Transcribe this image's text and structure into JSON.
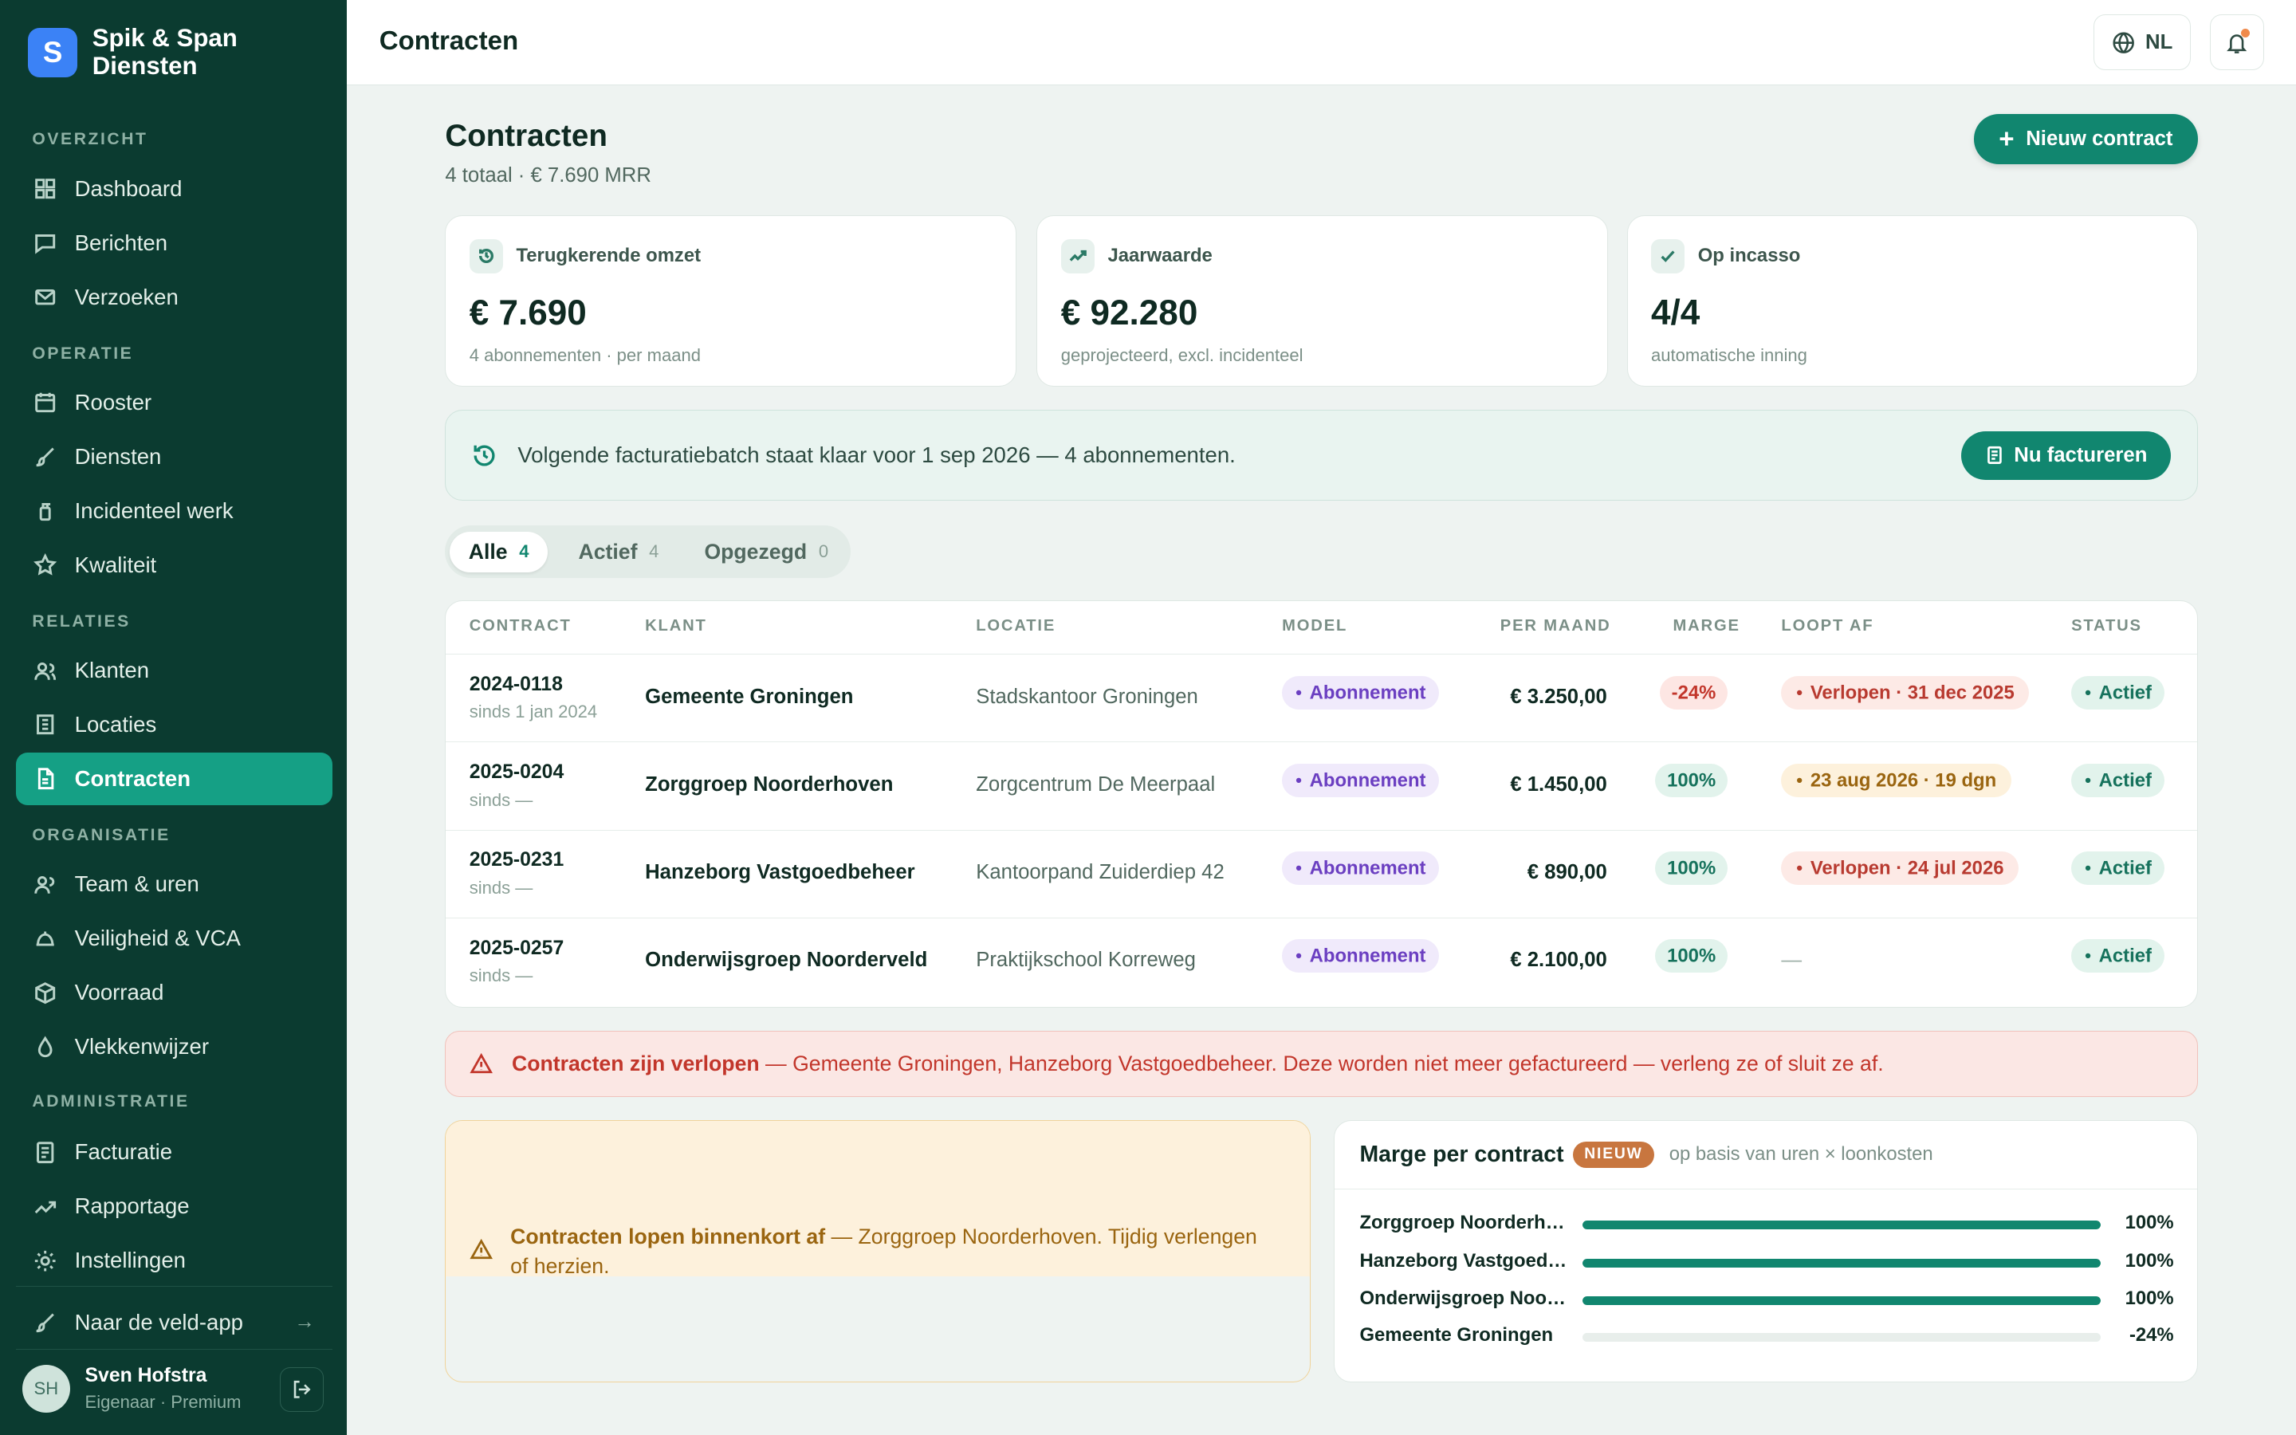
{
  "brand": {
    "name": "Spik & Span\nDiensten",
    "logo_letter": "S"
  },
  "sidebar": {
    "sections": [
      {
        "label": "OVERZICHT",
        "items": [
          {
            "label": "Dashboard",
            "icon": "grid-icon"
          },
          {
            "label": "Berichten",
            "icon": "message-icon"
          },
          {
            "label": "Verzoeken",
            "icon": "mail-icon"
          }
        ]
      },
      {
        "label": "OPERATIE",
        "items": [
          {
            "label": "Rooster",
            "icon": "calendar-icon"
          },
          {
            "label": "Diensten",
            "icon": "brush-icon"
          },
          {
            "label": "Incidenteel werk",
            "icon": "spray-icon"
          },
          {
            "label": "Kwaliteit",
            "icon": "star-icon"
          }
        ]
      },
      {
        "label": "RELATIES",
        "items": [
          {
            "label": "Klanten",
            "icon": "users-icon"
          },
          {
            "label": "Locaties",
            "icon": "building-icon"
          },
          {
            "label": "Contracten",
            "icon": "document-icon",
            "active": true
          }
        ]
      },
      {
        "label": "ORGANISATIE",
        "items": [
          {
            "label": "Team & uren",
            "icon": "team-icon"
          },
          {
            "label": "Veiligheid & VCA",
            "icon": "helmet-icon"
          },
          {
            "label": "Voorraad",
            "icon": "box-icon"
          },
          {
            "label": "Vlekkenwijzer",
            "icon": "drop-icon"
          }
        ]
      },
      {
        "label": "ADMINISTRATIE",
        "items": [
          {
            "label": "Facturatie",
            "icon": "invoice-icon"
          },
          {
            "label": "Rapportage",
            "icon": "trend-icon"
          },
          {
            "label": "Instellingen",
            "icon": "gear-icon"
          }
        ]
      }
    ],
    "field_app": "Naar de veld-app",
    "user": {
      "initials": "SH",
      "name": "Sven Hofstra",
      "role": "Eigenaar · Premium"
    }
  },
  "topbar": {
    "title": "Contracten",
    "lang": "NL"
  },
  "header": {
    "title": "Contracten",
    "subtitle": "4 totaal · € 7.690 MRR",
    "new_button": "Nieuw contract"
  },
  "stats": [
    {
      "label": "Terugkerende omzet",
      "value": "€ 7.690",
      "sub": "4 abonnementen · per maand",
      "icon": "history-icon"
    },
    {
      "label": "Jaarwaarde",
      "value": "€ 92.280",
      "sub": "geprojecteerd, excl. incidenteel",
      "icon": "trend-icon"
    },
    {
      "label": "Op incasso",
      "value": "4/4",
      "sub": "automatische inning",
      "icon": "check-icon"
    }
  ],
  "batch": {
    "text": "Volgende facturatiebatch staat klaar voor 1 sep 2026 — 4 abonnementen.",
    "button": "Nu factureren"
  },
  "tabs": [
    {
      "label": "Alle",
      "count": "4",
      "active": true
    },
    {
      "label": "Actief",
      "count": "4"
    },
    {
      "label": "Opgezegd",
      "count": "0"
    }
  ],
  "table": {
    "headers": [
      "CONTRACT",
      "KLANT",
      "LOCATIE",
      "MODEL",
      "PER MAAND",
      "MARGE",
      "LOOPT AF",
      "STATUS"
    ],
    "rows": [
      {
        "id": "2024-0118",
        "since": "sinds 1 jan 2024",
        "klant": "Gemeente Groningen",
        "locatie": "Stadskantoor Groningen",
        "model": "Abonnement",
        "amount": "€ 3.250,00",
        "marge": "-24%",
        "marge_type": "bad",
        "expiry": "Verlopen · 31 dec 2025",
        "expiry_type": "red",
        "status": "Actief"
      },
      {
        "id": "2025-0204",
        "since": "sinds —",
        "klant": "Zorggroep Noorderhoven",
        "locatie": "Zorgcentrum De Meerpaal",
        "model": "Abonnement",
        "amount": "€ 1.450,00",
        "marge": "100%",
        "marge_type": "good",
        "expiry": "23 aug 2026 · 19 dgn",
        "expiry_type": "amber",
        "status": "Actief"
      },
      {
        "id": "2025-0231",
        "since": "sinds —",
        "klant": "Hanzeborg Vastgoedbeheer",
        "locatie": "Kantoorpand Zuiderdiep 42",
        "model": "Abonnement",
        "amount": "€ 890,00",
        "marge": "100%",
        "marge_type": "good",
        "expiry": "Verlopen · 24 jul 2026",
        "expiry_type": "red",
        "status": "Actief"
      },
      {
        "id": "2025-0257",
        "since": "sinds —",
        "klant": "Onderwijsgroep Noorderveld",
        "locatie": "Praktijkschool Korreweg",
        "model": "Abonnement",
        "amount": "€ 2.100,00",
        "marge": "100%",
        "marge_type": "good",
        "expiry": "—",
        "expiry_type": "none",
        "status": "Actief"
      }
    ]
  },
  "alerts": {
    "expired_bold": "Contracten zijn verlopen",
    "expired_text": " — Gemeente Groningen, Hanzeborg Vastgoedbeheer. Deze worden niet meer gefactureerd — verleng ze of sluit ze af.",
    "soon_bold": "Contracten lopen binnenkort af",
    "soon_text": " — Zorggroep Noorderhoven. Tijdig verlengen of herzien."
  },
  "marge_card": {
    "title": "Marge per contract",
    "badge": "NIEUW",
    "note": "op basis van uren × loonkosten",
    "rows": [
      {
        "name": "Zorggroep Noorderhoven",
        "value": "100%",
        "fill": 1.0
      },
      {
        "name": "Hanzeborg Vastgoedbeheer",
        "value": "100%",
        "fill": 1.0
      },
      {
        "name": "Onderwijsgroep Noorderveld",
        "value": "100%",
        "fill": 1.0
      },
      {
        "name": "Gemeente Groningen",
        "value": "-24%",
        "fill": 0
      }
    ]
  },
  "colors": {
    "sidebar": "#0b3b30",
    "accent": "#11866f",
    "active_nav": "#15a085",
    "danger": "#c2362b",
    "warning": "#9a6510"
  }
}
